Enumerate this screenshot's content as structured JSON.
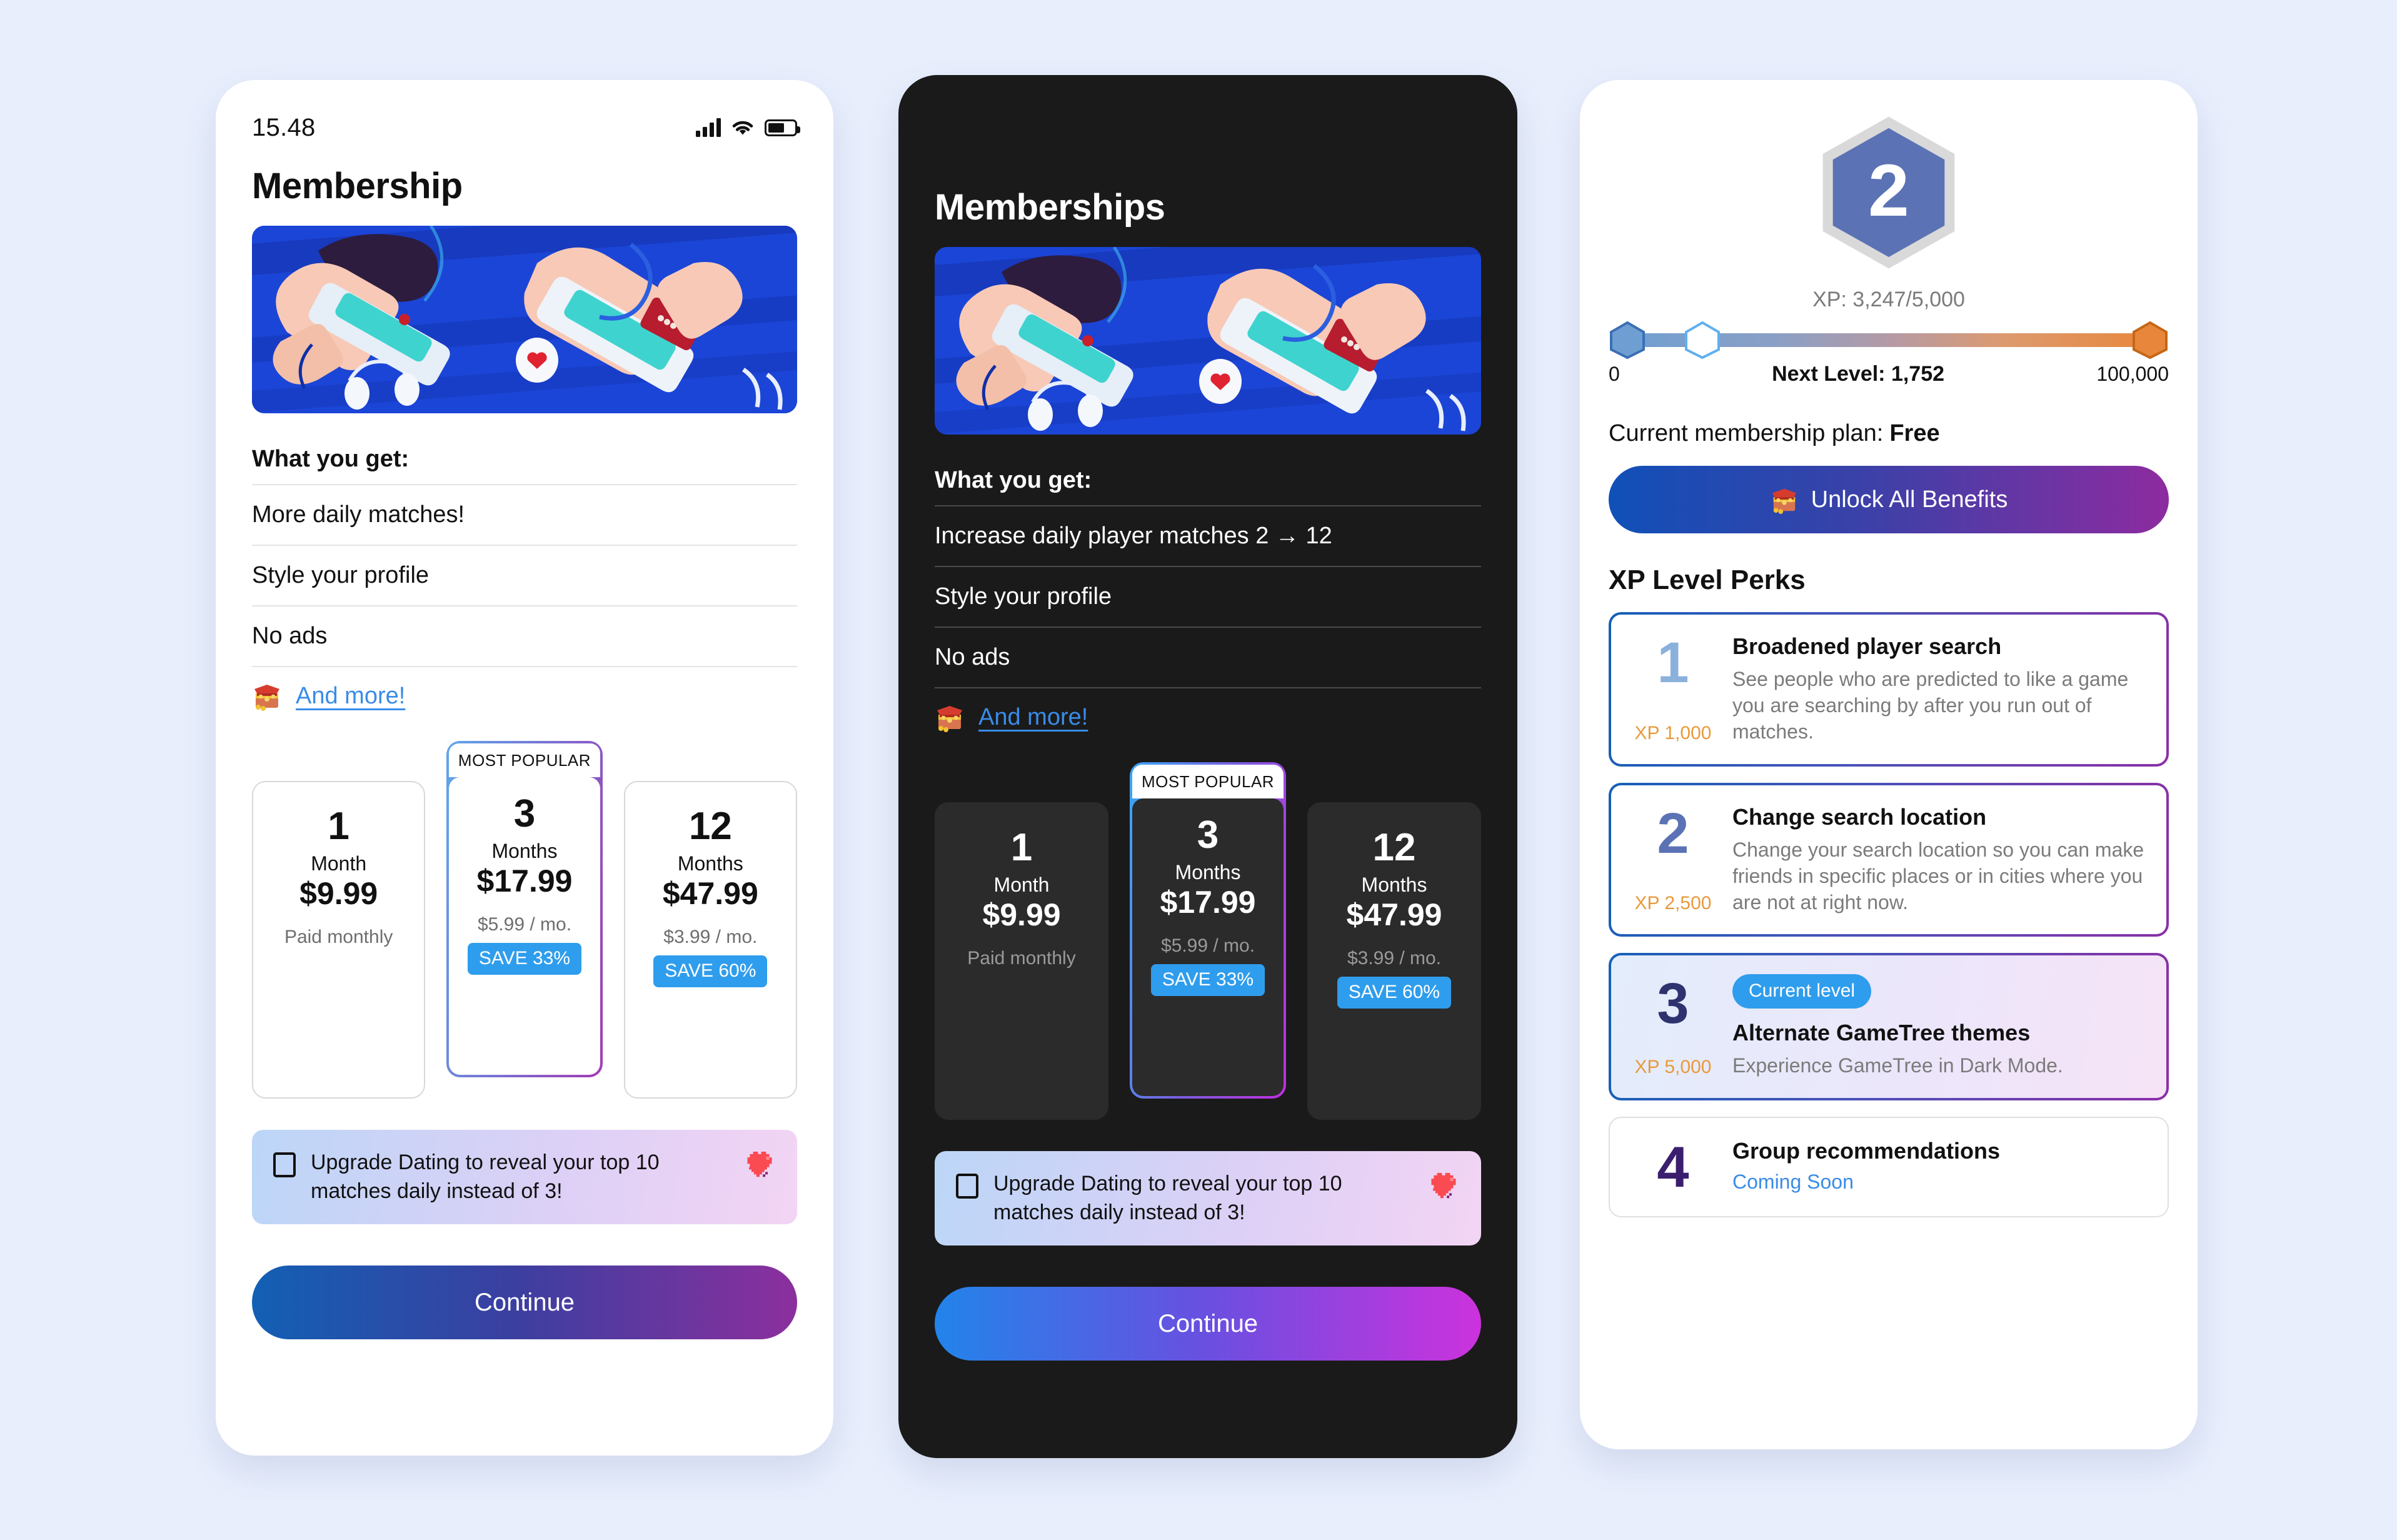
{
  "light_phone": {
    "status": {
      "time": "15.48",
      "signal_icon": "cellular-signal-icon",
      "wifi_icon": "wifi-icon",
      "battery_icon": "battery-icon"
    },
    "title": "Membership",
    "hero_alt": "two-people-gaming-illustration",
    "benefits": {
      "heading": "What you get:",
      "items": [
        "More daily matches!",
        "Style your profile",
        "No ads"
      ],
      "more_link": "And more!",
      "more_icon": "treasure-chest-icon"
    },
    "plans": [
      {
        "num": "1",
        "unit": "Month",
        "price": "$9.99",
        "sub": "Paid monthly",
        "save": "",
        "featured": false,
        "badge": ""
      },
      {
        "num": "3",
        "unit": "Months",
        "price": "$17.99",
        "sub": "$5.99 / mo.",
        "save": "SAVE 33%",
        "featured": true,
        "badge": "MOST POPULAR"
      },
      {
        "num": "12",
        "unit": "Months",
        "price": "$47.99",
        "sub": "$3.99 / mo.",
        "save": "SAVE 60%",
        "featured": false,
        "badge": ""
      }
    ],
    "upgrade": {
      "checkbox_checked": false,
      "text": "Upgrade Dating to reveal your top 10 matches daily instead of 3!",
      "icon": "heart-icon"
    },
    "continue_label": "Continue"
  },
  "dark_phone": {
    "title": "Memberships",
    "hero_alt": "two-people-gaming-illustration",
    "benefits": {
      "heading": "What you get:",
      "items": [
        "Increase daily player matches 2 → 12",
        "Style your profile",
        "No ads"
      ],
      "more_link": "And more!",
      "more_icon": "treasure-chest-icon"
    },
    "plans": [
      {
        "num": "1",
        "unit": "Month",
        "price": "$9.99",
        "sub": "Paid monthly",
        "save": "",
        "featured": false,
        "badge": ""
      },
      {
        "num": "3",
        "unit": "Months",
        "price": "$17.99",
        "sub": "$5.99 / mo.",
        "save": "SAVE 33%",
        "featured": true,
        "badge": "MOST POPULAR"
      },
      {
        "num": "12",
        "unit": "Months",
        "price": "$47.99",
        "sub": "$3.99 / mo.",
        "save": "SAVE 60%",
        "featured": false,
        "badge": ""
      }
    ],
    "upgrade": {
      "checkbox_checked": false,
      "text": "Upgrade Dating to reveal your top 10 matches daily instead of 3!",
      "icon": "heart-icon"
    },
    "continue_label": "Continue"
  },
  "xp_phone": {
    "level_badge": "2",
    "xp_count": "XP: 3,247/5,000",
    "scale_min": "0",
    "scale_next": "Next Level: 1,752",
    "scale_max": "100,000",
    "plan_label": "Current membership plan:",
    "plan_value": "Free",
    "unlock_label": "Unlock All Benefits",
    "unlock_icon": "treasure-chest-icon",
    "perks_title": "XP Level Perks",
    "perks": [
      {
        "num": "1",
        "xp": "XP 1,000",
        "head": "Broadened player search",
        "desc": "See people who are predicted to like a game you are searching by after you run out of matches.",
        "chip": "",
        "state": "locked"
      },
      {
        "num": "2",
        "xp": "XP 2,500",
        "head": "Change search location",
        "desc": "Change your search location so you can make friends in specific places or in cities where you are not at right now.",
        "chip": "",
        "state": "locked"
      },
      {
        "num": "3",
        "xp": "XP 5,000",
        "head": "Alternate GameTree themes",
        "desc": "Experience GameTree in Dark Mode.",
        "chip": "Current level",
        "state": "current"
      },
      {
        "num": "4",
        "xp": "",
        "head": "Group recommendations",
        "desc": "",
        "chip": "",
        "coming_soon": "Coming Soon",
        "state": "coming"
      }
    ]
  },
  "colors": {
    "page_bg": "#e8eefc",
    "accent_blue": "#2f9ded",
    "gradient_start": "#1260b4",
    "gradient_end": "#8c2f9e",
    "xp_orange": "#e89a3c",
    "dark_bg": "#1a1a1a"
  }
}
